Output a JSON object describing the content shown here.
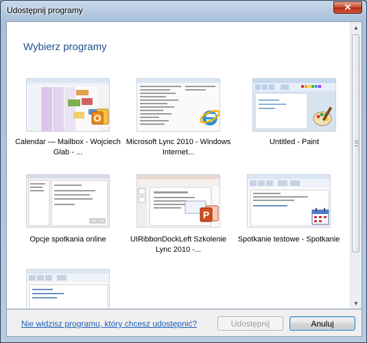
{
  "window": {
    "title": "Udostępnij programy",
    "close_glyph": "✕"
  },
  "heading": "Wybierz programy",
  "programs": [
    {
      "label": "Calendar — Mailbox - Wojciech Glab - ...",
      "icon": "outlook-icon"
    },
    {
      "label": "Microsoft Lync 2010 - Windows Internet...",
      "icon": "internet-explorer-icon"
    },
    {
      "label": "Untitled - Paint",
      "icon": "paint-icon"
    },
    {
      "label": "Opcje spotkania online",
      "icon": ""
    },
    {
      "label": "UIRibbonDockLeft Szkolenie Lync 2010 -...",
      "icon": "powerpoint-icon"
    },
    {
      "label": "Spotkanie testowe - Spotkanie",
      "icon": "calendar-icon"
    },
    {
      "label": "",
      "icon": ""
    }
  ],
  "footer": {
    "link_text": "Nie widzisz programu, który chcesz udostępnić?",
    "share_button": "Udostępnij",
    "cancel_button": "Anuluj"
  },
  "colors": {
    "heading": "#1e4e8c",
    "link": "#1a5bb8",
    "close_button": "#c7462b"
  }
}
